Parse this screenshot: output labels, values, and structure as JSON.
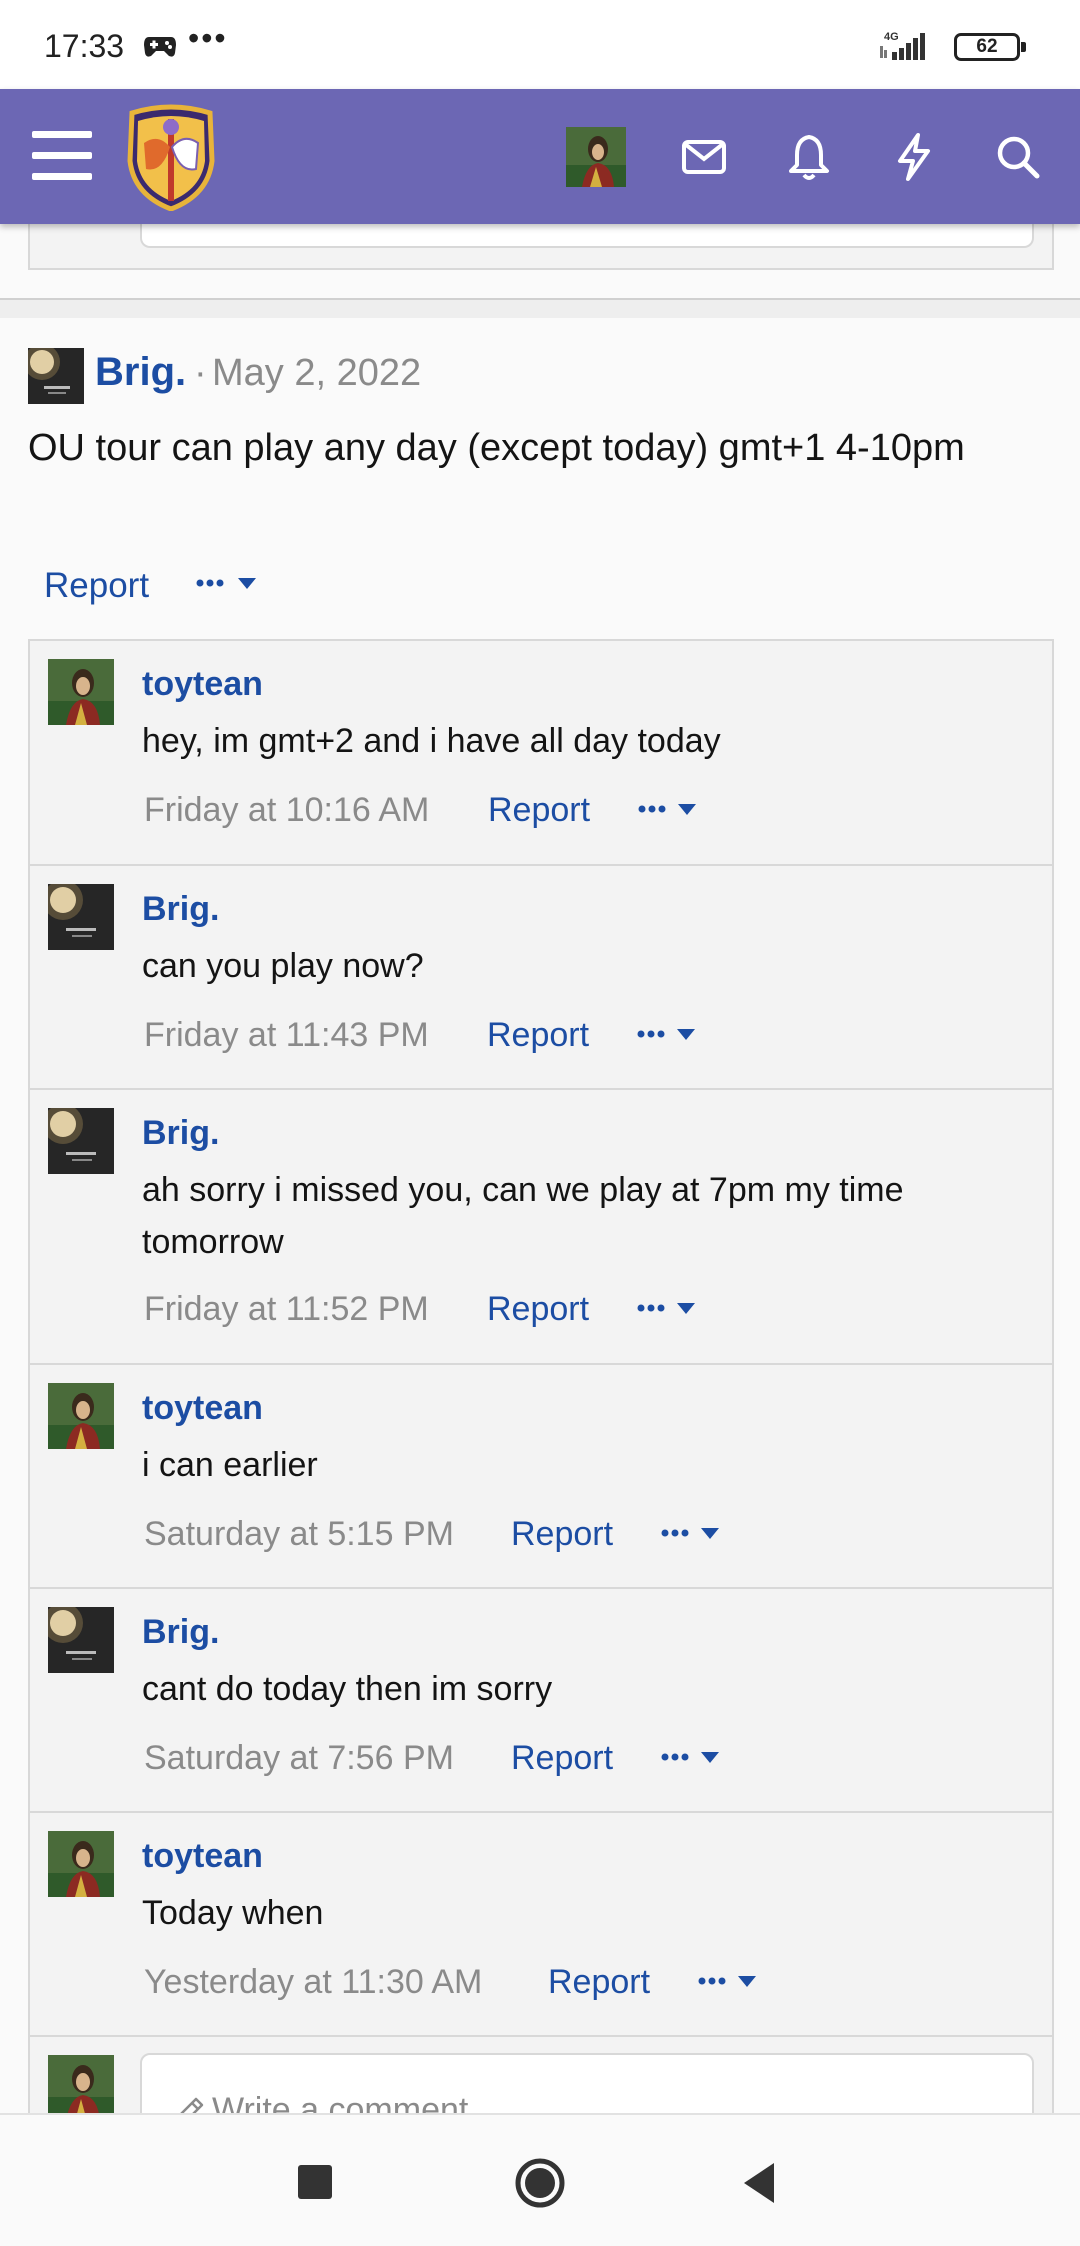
{
  "status_bar": {
    "time": "17:33",
    "dots": "•••",
    "network": "4G",
    "battery": "62",
    "icons": [
      "gamepad-icon",
      "signal-icon",
      "battery-icon"
    ]
  },
  "header": {
    "icons": [
      "menu-icon",
      "site-logo",
      "user-avatar",
      "mail-icon",
      "bell-icon",
      "bolt-icon",
      "search-icon"
    ],
    "color": "#6c67b4"
  },
  "post": {
    "author": "Brig.",
    "separator": "·",
    "date": "May 2, 2022",
    "text": "OU tour can play any day (except today) gmt+1 4-10pm",
    "report_label": "Report"
  },
  "comments": [
    {
      "author": "toytean",
      "avatar": "toytean",
      "text": "hey, im gmt+2 and i have all day today",
      "time": "Friday at 10:16 AM",
      "report_label": "Report"
    },
    {
      "author": "Brig.",
      "avatar": "brig",
      "text": "can you play now?",
      "time": "Friday at 11:43 PM",
      "report_label": "Report"
    },
    {
      "author": "Brig.",
      "avatar": "brig",
      "text": "ah sorry i missed you, can we play at 7pm my time tomorrow",
      "time": "Friday at 11:52 PM",
      "report_label": "Report"
    },
    {
      "author": "toytean",
      "avatar": "toytean",
      "text": "i can earlier",
      "time": "Saturday at 5:15 PM",
      "report_label": "Report"
    },
    {
      "author": "Brig.",
      "avatar": "brig",
      "text": "cant do today then im sorry",
      "time": "Saturday at 7:56 PM",
      "report_label": "Report"
    },
    {
      "author": "toytean",
      "avatar": "toytean",
      "text": "Today when",
      "time": "Yesterday at 11:30 AM",
      "report_label": "Report"
    }
  ],
  "comment_input": {
    "placeholder": "Write a comment..."
  },
  "colors": {
    "link": "#1c4da3",
    "meta": "#8a8a8a",
    "header": "#6c67b4"
  }
}
